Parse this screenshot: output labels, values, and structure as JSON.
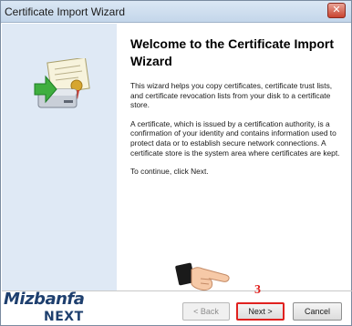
{
  "window": {
    "title": "Certificate Import Wizard"
  },
  "main": {
    "title": "Welcome to the Certificate Import Wizard",
    "paragraphs": [
      "This wizard helps you copy certificates, certificate trust lists, and certificate revocation lists from your disk to a certificate store.",
      "A certificate, which is issued by a certification authority, is a confirmation of your identity and contains information used to protect data or to establish secure network connections. A certificate store is the system area where certificates are kept.",
      "To continue, click Next."
    ]
  },
  "buttons": {
    "back": "< Back",
    "next": "Next >",
    "cancel": "Cancel"
  },
  "annotation": {
    "step": "3"
  },
  "watermark": {
    "line1": "Mizbanfa",
    "line2": "NEXT"
  },
  "colors": {
    "accent": "#e0211f",
    "left_panel": "#dfe9f5",
    "brand": "#1e3f6e"
  },
  "icons": {
    "wizard_art": "certificate-import-icon",
    "pointer": "pointing-hand-icon"
  }
}
